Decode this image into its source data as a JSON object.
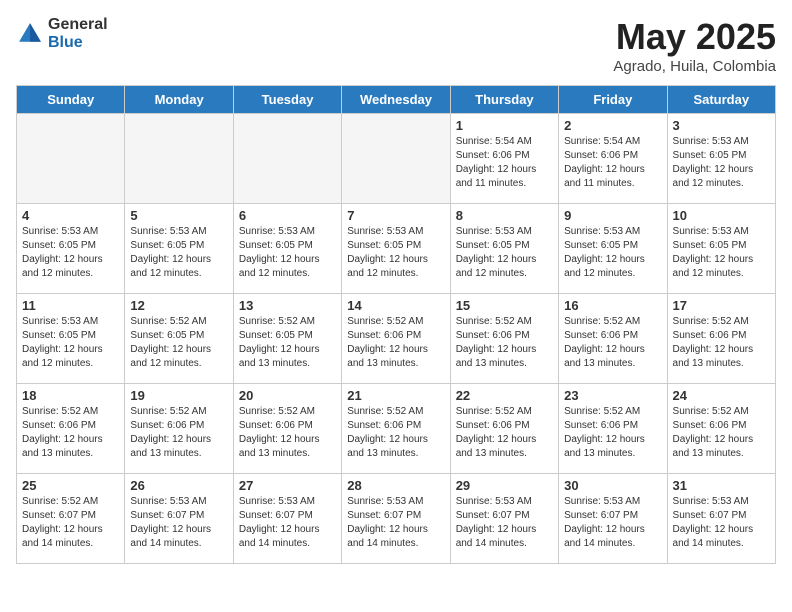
{
  "header": {
    "logo_general": "General",
    "logo_blue": "Blue",
    "month": "May 2025",
    "location": "Agrado, Huila, Colombia"
  },
  "days_of_week": [
    "Sunday",
    "Monday",
    "Tuesday",
    "Wednesday",
    "Thursday",
    "Friday",
    "Saturday"
  ],
  "weeks": [
    [
      {
        "day": "",
        "info": ""
      },
      {
        "day": "",
        "info": ""
      },
      {
        "day": "",
        "info": ""
      },
      {
        "day": "",
        "info": ""
      },
      {
        "day": "1",
        "info": "Sunrise: 5:54 AM\nSunset: 6:06 PM\nDaylight: 12 hours\nand 11 minutes."
      },
      {
        "day": "2",
        "info": "Sunrise: 5:54 AM\nSunset: 6:06 PM\nDaylight: 12 hours\nand 11 minutes."
      },
      {
        "day": "3",
        "info": "Sunrise: 5:53 AM\nSunset: 6:05 PM\nDaylight: 12 hours\nand 12 minutes."
      }
    ],
    [
      {
        "day": "4",
        "info": "Sunrise: 5:53 AM\nSunset: 6:05 PM\nDaylight: 12 hours\nand 12 minutes."
      },
      {
        "day": "5",
        "info": "Sunrise: 5:53 AM\nSunset: 6:05 PM\nDaylight: 12 hours\nand 12 minutes."
      },
      {
        "day": "6",
        "info": "Sunrise: 5:53 AM\nSunset: 6:05 PM\nDaylight: 12 hours\nand 12 minutes."
      },
      {
        "day": "7",
        "info": "Sunrise: 5:53 AM\nSunset: 6:05 PM\nDaylight: 12 hours\nand 12 minutes."
      },
      {
        "day": "8",
        "info": "Sunrise: 5:53 AM\nSunset: 6:05 PM\nDaylight: 12 hours\nand 12 minutes."
      },
      {
        "day": "9",
        "info": "Sunrise: 5:53 AM\nSunset: 6:05 PM\nDaylight: 12 hours\nand 12 minutes."
      },
      {
        "day": "10",
        "info": "Sunrise: 5:53 AM\nSunset: 6:05 PM\nDaylight: 12 hours\nand 12 minutes."
      }
    ],
    [
      {
        "day": "11",
        "info": "Sunrise: 5:53 AM\nSunset: 6:05 PM\nDaylight: 12 hours\nand 12 minutes."
      },
      {
        "day": "12",
        "info": "Sunrise: 5:52 AM\nSunset: 6:05 PM\nDaylight: 12 hours\nand 12 minutes."
      },
      {
        "day": "13",
        "info": "Sunrise: 5:52 AM\nSunset: 6:05 PM\nDaylight: 12 hours\nand 13 minutes."
      },
      {
        "day": "14",
        "info": "Sunrise: 5:52 AM\nSunset: 6:06 PM\nDaylight: 12 hours\nand 13 minutes."
      },
      {
        "day": "15",
        "info": "Sunrise: 5:52 AM\nSunset: 6:06 PM\nDaylight: 12 hours\nand 13 minutes."
      },
      {
        "day": "16",
        "info": "Sunrise: 5:52 AM\nSunset: 6:06 PM\nDaylight: 12 hours\nand 13 minutes."
      },
      {
        "day": "17",
        "info": "Sunrise: 5:52 AM\nSunset: 6:06 PM\nDaylight: 12 hours\nand 13 minutes."
      }
    ],
    [
      {
        "day": "18",
        "info": "Sunrise: 5:52 AM\nSunset: 6:06 PM\nDaylight: 12 hours\nand 13 minutes."
      },
      {
        "day": "19",
        "info": "Sunrise: 5:52 AM\nSunset: 6:06 PM\nDaylight: 12 hours\nand 13 minutes."
      },
      {
        "day": "20",
        "info": "Sunrise: 5:52 AM\nSunset: 6:06 PM\nDaylight: 12 hours\nand 13 minutes."
      },
      {
        "day": "21",
        "info": "Sunrise: 5:52 AM\nSunset: 6:06 PM\nDaylight: 12 hours\nand 13 minutes."
      },
      {
        "day": "22",
        "info": "Sunrise: 5:52 AM\nSunset: 6:06 PM\nDaylight: 12 hours\nand 13 minutes."
      },
      {
        "day": "23",
        "info": "Sunrise: 5:52 AM\nSunset: 6:06 PM\nDaylight: 12 hours\nand 13 minutes."
      },
      {
        "day": "24",
        "info": "Sunrise: 5:52 AM\nSunset: 6:06 PM\nDaylight: 12 hours\nand 13 minutes."
      }
    ],
    [
      {
        "day": "25",
        "info": "Sunrise: 5:52 AM\nSunset: 6:07 PM\nDaylight: 12 hours\nand 14 minutes."
      },
      {
        "day": "26",
        "info": "Sunrise: 5:53 AM\nSunset: 6:07 PM\nDaylight: 12 hours\nand 14 minutes."
      },
      {
        "day": "27",
        "info": "Sunrise: 5:53 AM\nSunset: 6:07 PM\nDaylight: 12 hours\nand 14 minutes."
      },
      {
        "day": "28",
        "info": "Sunrise: 5:53 AM\nSunset: 6:07 PM\nDaylight: 12 hours\nand 14 minutes."
      },
      {
        "day": "29",
        "info": "Sunrise: 5:53 AM\nSunset: 6:07 PM\nDaylight: 12 hours\nand 14 minutes."
      },
      {
        "day": "30",
        "info": "Sunrise: 5:53 AM\nSunset: 6:07 PM\nDaylight: 12 hours\nand 14 minutes."
      },
      {
        "day": "31",
        "info": "Sunrise: 5:53 AM\nSunset: 6:07 PM\nDaylight: 12 hours\nand 14 minutes."
      }
    ]
  ]
}
